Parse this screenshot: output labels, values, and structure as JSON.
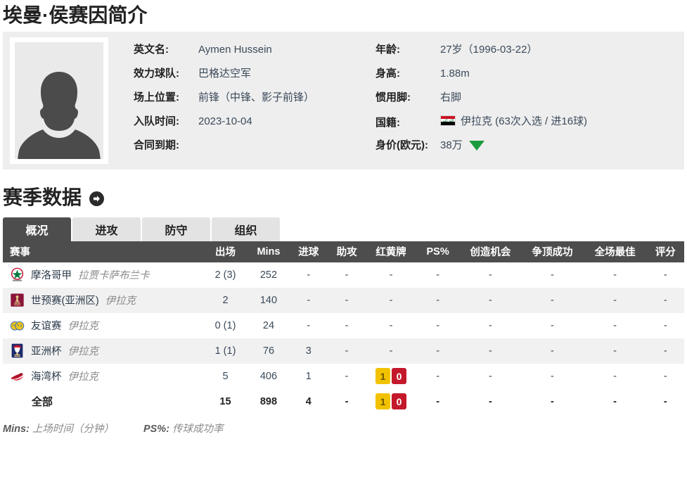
{
  "page_title": "埃曼·侯赛因简介",
  "profile": {
    "avatar_alt": "player-photo-placeholder",
    "left": [
      {
        "label": "英文名:",
        "value": "Aymen Hussein"
      },
      {
        "label": "效力球队:",
        "value": "巴格达空军"
      },
      {
        "label": "场上位置:",
        "value": "前锋（中锋、影子前锋）"
      },
      {
        "label": "入队时间:",
        "value": "2023-10-04"
      },
      {
        "label": "合同到期:",
        "value": ""
      }
    ],
    "right": [
      {
        "label": "年龄:",
        "value": "27岁（1996-03-22）"
      },
      {
        "label": "身高:",
        "value": "1.88m"
      },
      {
        "label": "惯用脚:",
        "value": "右脚"
      },
      {
        "label": "国籍:",
        "value": "伊拉克 (63次入选 / 进16球)",
        "flag": "iraq-flag"
      },
      {
        "label": "身价(欧元):",
        "value": "38万",
        "trend": "down-green"
      }
    ]
  },
  "season": {
    "heading": "赛季数据",
    "arrow_icon": "circle-arrow-right-icon",
    "tabs": [
      {
        "label": "概况",
        "active": true
      },
      {
        "label": "进攻",
        "active": false
      },
      {
        "label": "防守",
        "active": false
      },
      {
        "label": "组织",
        "active": false
      }
    ],
    "columns": [
      "赛事",
      "出场",
      "Mins",
      "进球",
      "助攻",
      "红黄牌",
      "PS%",
      "创造机会",
      "争顶成功",
      "全场最佳",
      "评分"
    ],
    "rows": [
      {
        "logo": "morocco-botola-logo",
        "competition": "摩洛哥甲",
        "team": "拉贾卡萨布兰卡",
        "apps": "2 (3)",
        "mins": "252",
        "goals": "-",
        "assists": "-",
        "cards": null,
        "cards_text": "-",
        "ps": "-",
        "chances": "-",
        "aerials": "-",
        "motm": "-",
        "rating": "-"
      },
      {
        "logo": "world-cup-qualifiers-logo",
        "competition": "世预赛(亚洲区)",
        "team": "伊拉克",
        "apps": "2",
        "mins": "140",
        "goals": "-",
        "assists": "-",
        "cards": null,
        "cards_text": "-",
        "ps": "-",
        "chances": "-",
        "aerials": "-",
        "motm": "-",
        "rating": "-"
      },
      {
        "logo": "friendly-match-logo",
        "competition": "友谊赛",
        "team": "伊拉克",
        "apps": "0 (1)",
        "mins": "24",
        "goals": "-",
        "assists": "-",
        "cards": null,
        "cards_text": "-",
        "ps": "-",
        "chances": "-",
        "aerials": "-",
        "motm": "-",
        "rating": "-"
      },
      {
        "logo": "asian-cup-logo",
        "competition": "亚洲杯",
        "team": "伊拉克",
        "apps": "1 (1)",
        "mins": "76",
        "goals": "3",
        "assists": "-",
        "cards": null,
        "cards_text": "-",
        "ps": "-",
        "chances": "-",
        "aerials": "-",
        "motm": "-",
        "rating": "-"
      },
      {
        "logo": "gulf-cup-logo",
        "competition": "海湾杯",
        "team": "伊拉克",
        "apps": "5",
        "mins": "406",
        "goals": "1",
        "assists": "-",
        "cards": {
          "yellow": "1",
          "red": "0"
        },
        "cards_text": "",
        "ps": "-",
        "chances": "-",
        "aerials": "-",
        "motm": "-",
        "rating": "-"
      }
    ],
    "total": {
      "competition": "全部",
      "team": "",
      "apps": "15",
      "mins": "898",
      "goals": "4",
      "assists": "-",
      "cards": {
        "yellow": "1",
        "red": "0"
      },
      "ps": "-",
      "chances": "-",
      "aerials": "-",
      "motm": "-",
      "rating": "-"
    }
  },
  "footnote": {
    "mins_key": "Mins:",
    "mins_desc": "上场时间（分钟）",
    "ps_key": "PS%:",
    "ps_desc": "传球成功率"
  },
  "colors": {
    "header_bar": "#4d4d4d",
    "tab_active": "#4d4d4d",
    "tab_inactive": "#e3e3e3",
    "card_yellow": "#f2c200",
    "card_red": "#c3192b",
    "trend_down": "#1a9c3c",
    "profile_bg": "#eeeeee",
    "row_alt": "#f1f1f1",
    "value_text": "#3b4a5a",
    "muted_text": "#8a8a8a"
  }
}
